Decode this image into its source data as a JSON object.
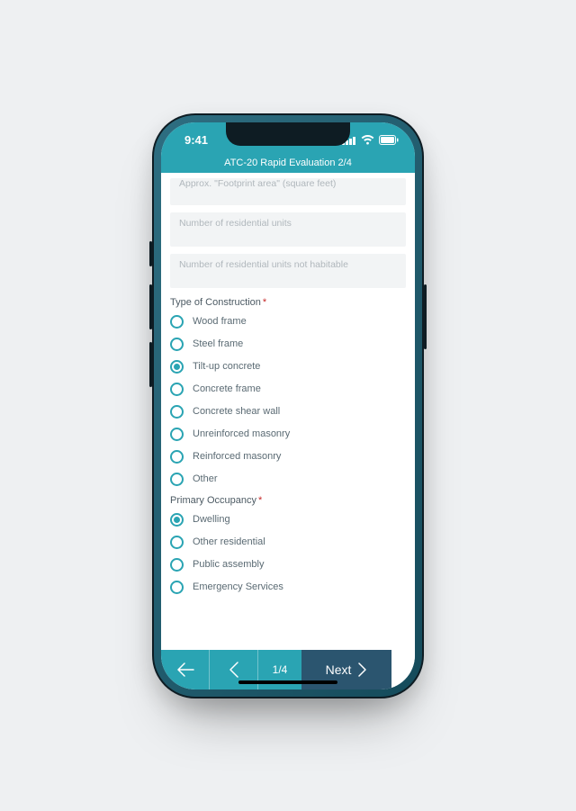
{
  "statusbar": {
    "time": "9:41"
  },
  "header": {
    "title": "ATC-20 Rapid Evaluation 2/4"
  },
  "inputs": {
    "footprint": {
      "placeholder": "Approx. \"Footprint area\" (square feet)"
    },
    "units": {
      "placeholder": "Number of residential units"
    },
    "uninhabitable": {
      "placeholder": "Number of residential units not habitable"
    }
  },
  "sections": {
    "construction": {
      "label": "Type of Construction",
      "options": [
        "Wood frame",
        "Steel frame",
        "Tilt-up concrete",
        "Concrete frame",
        "Concrete shear wall",
        "Unreinforced masonry",
        "Reinforced masonry",
        "Other"
      ]
    },
    "occupancy": {
      "label": "Primary Occupancy",
      "options": [
        "Dwelling",
        "Other residential",
        "Public assembly",
        "Emergency Services"
      ]
    }
  },
  "nav": {
    "page": "1/4",
    "next": "Next"
  }
}
